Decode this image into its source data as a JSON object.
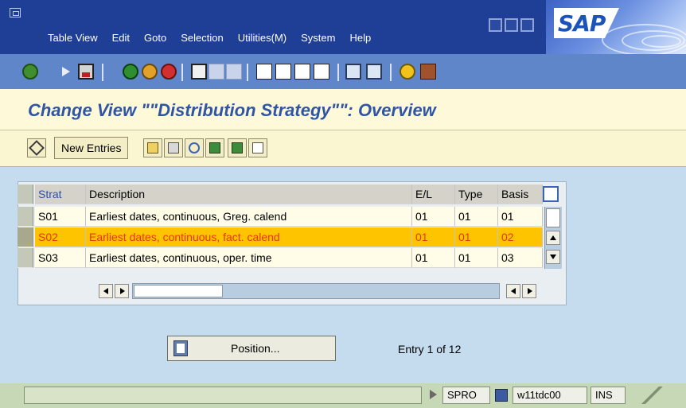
{
  "menu": [
    "Table View",
    "Edit",
    "Goto",
    "Selection",
    "Utilities(M)",
    "System",
    "Help"
  ],
  "brand": {
    "logo_text": "SAP"
  },
  "toolbar_icons": [
    "enter-icon",
    "command-field-icon",
    "save-icon",
    "back-icon",
    "exit-icon",
    "cancel-icon",
    "print-icon",
    "find-icon",
    "find-next-icon",
    "first-page-icon",
    "previous-page-icon",
    "next-page-icon",
    "last-page-icon",
    "create-session-icon",
    "shortcut-icon",
    "help-icon",
    "layout-menu-icon"
  ],
  "page": {
    "title": "Change View \"\"Distribution Strategy\"\": Overview"
  },
  "app_toolbar": {
    "new_entries_label": "New Entries"
  },
  "table": {
    "columns": [
      "Strat",
      "Description",
      "E/L",
      "Type",
      "Basis"
    ],
    "rows": [
      {
        "strat": "S01",
        "description": "Earliest dates, continuous, Greg. calend",
        "el": "01",
        "type": "01",
        "basis": "01"
      },
      {
        "strat": "S02",
        "description": "Earliest dates, continuous, fact. calend",
        "el": "01",
        "type": "01",
        "basis": "02"
      },
      {
        "strat": "S03",
        "description": "Earliest dates, continuous, oper. time",
        "el": "01",
        "type": "01",
        "basis": "03"
      }
    ],
    "highlighted_row": 1
  },
  "position_button": {
    "label": "Position..."
  },
  "entry_info": "Entry 1 of 12",
  "status": {
    "transaction": "SPRO",
    "server": "w11tdc00",
    "mode": "INS"
  },
  "colors": {
    "title_bar": "#1f3f96",
    "toolbar": "#5f86c9",
    "title": "#2f55a4",
    "highlight_row": "#ffc400",
    "highlight_text": "#e53600",
    "work_area": "#c5dcef"
  }
}
